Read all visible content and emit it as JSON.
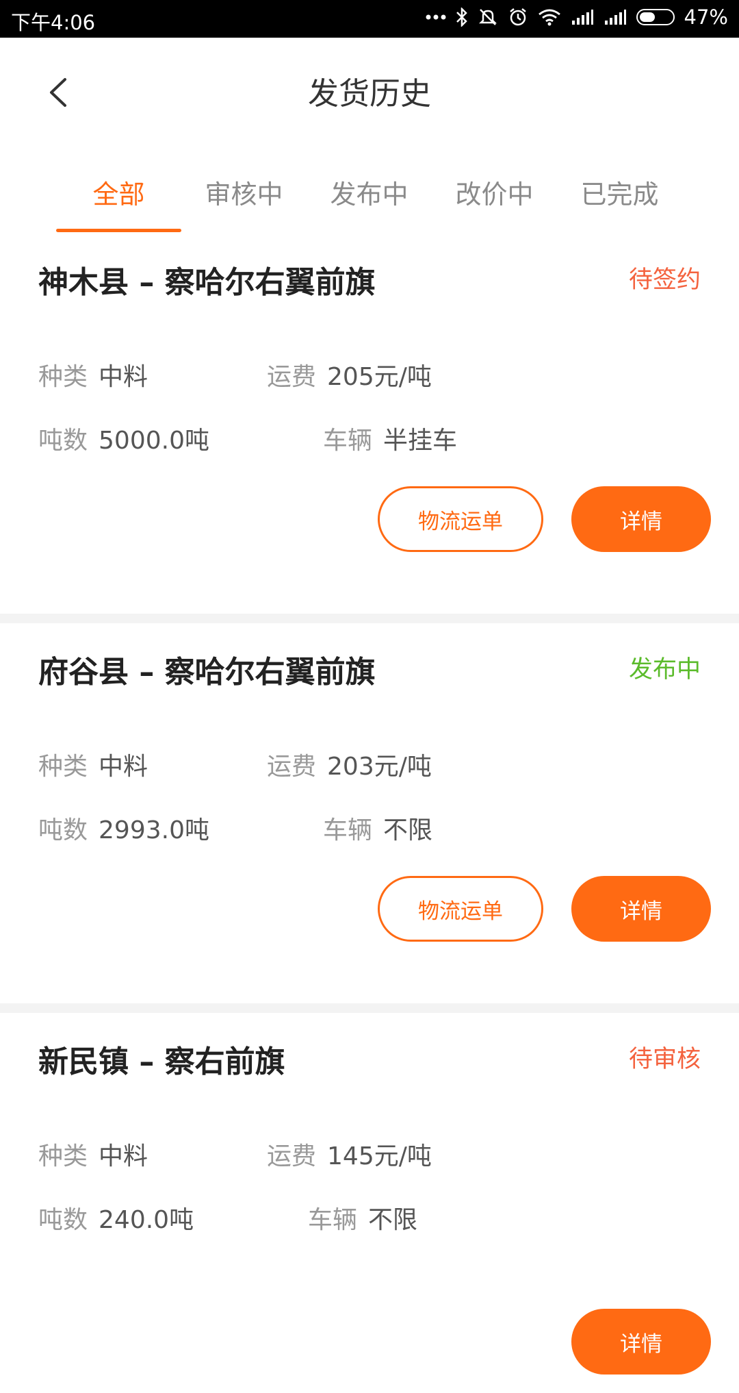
{
  "status_bar": {
    "time": "下午4:06",
    "battery_percent": "47%",
    "battery_level": 0.47,
    "icons": [
      "more-dots-icon",
      "bluetooth-icon",
      "mute-icon",
      "alarm-icon",
      "wifi-icon",
      "signal-icon",
      "signal-icon",
      "battery-icon"
    ]
  },
  "header": {
    "title": "发货历史",
    "back_icon": "back-arrow-icon"
  },
  "tabs": [
    {
      "label": "全部",
      "active": true
    },
    {
      "label": "审核中",
      "active": false
    },
    {
      "label": "发布中",
      "active": false
    },
    {
      "label": "改价中",
      "active": false
    },
    {
      "label": "已完成",
      "active": false
    }
  ],
  "colors": {
    "accent": "#ff6a13",
    "status_red": "#f4623e",
    "status_green": "#5bbb2b",
    "label_gray": "#999999"
  },
  "labels": {
    "type": "种类",
    "freight": "运费",
    "tonnage": "吨数",
    "vehicle": "车辆"
  },
  "buttons": {
    "waybill": "物流运单",
    "detail": "详情"
  },
  "orders": [
    {
      "route": "神木县 – 察哈尔右翼前旗",
      "status": "待签约",
      "status_color": "#f4623e",
      "type": "中料",
      "freight": "205元/吨",
      "tonnage": "5000.0吨",
      "vehicle": "半挂车"
    },
    {
      "route": "府谷县 – 察哈尔右翼前旗",
      "status": "发布中",
      "status_color": "#5bbb2b",
      "type": "中料",
      "freight": "203元/吨",
      "tonnage": "2993.0吨",
      "vehicle": "不限"
    },
    {
      "route": "新民镇 – 察右前旗",
      "status": "待审核",
      "status_color": "#f4623e",
      "type": "中料",
      "freight": "145元/吨",
      "tonnage": "240.0吨",
      "vehicle": "不限"
    }
  ]
}
